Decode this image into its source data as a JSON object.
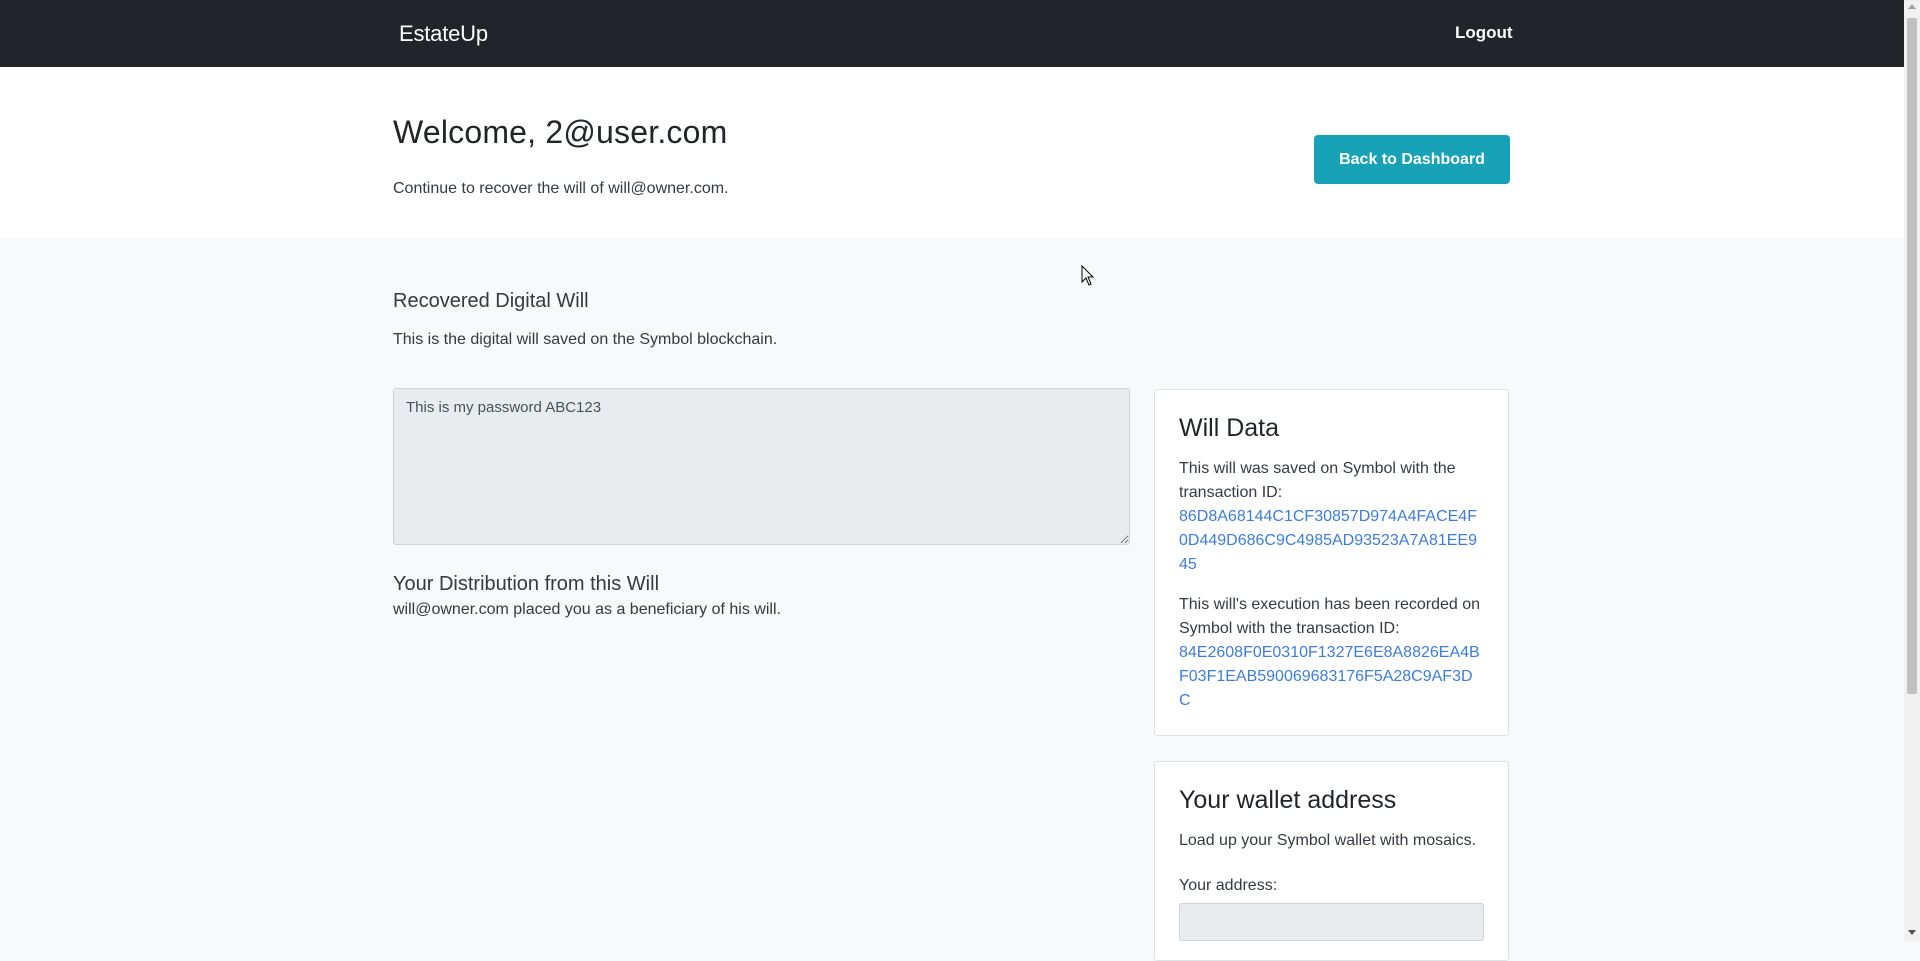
{
  "navbar": {
    "brand": "EstateUp",
    "logout_label": "Logout"
  },
  "hero": {
    "title": "Welcome, 2@user.com",
    "subtitle": "Continue to recover the will of will@owner.com.",
    "back_button_label": "Back to Dashboard"
  },
  "recovered_will": {
    "title": "Recovered Digital Will",
    "description": "This is the digital will saved on the Symbol blockchain.",
    "content": "This is my password ABC123"
  },
  "distribution": {
    "title": "Your Distribution from this Will",
    "description": "will@owner.com placed you as a beneficiary of his will."
  },
  "will_data_card": {
    "title": "Will Data",
    "saved_text": "This will was saved on Symbol with the transaction ID:",
    "saved_tx_id": "86D8A68144C1CF30857D974A4FACE4F0D449D686C9C4985AD93523A7A81EE945",
    "execution_text": "This will's execution has been recorded on Symbol with the transaction ID:",
    "execution_tx_id": "84E2608F0E0310F1327E6E8A8826EA4BF03F1EAB590069683176F5A28C9AF3DC"
  },
  "wallet_card": {
    "title": "Your wallet address",
    "description": "Load up your Symbol wallet with mosaics.",
    "address_label": "Your address:"
  },
  "colors": {
    "navbar_bg": "#212529",
    "primary_button": "#17a2b8",
    "link": "#3b7ddd",
    "page_bg": "#f8f9fa"
  }
}
